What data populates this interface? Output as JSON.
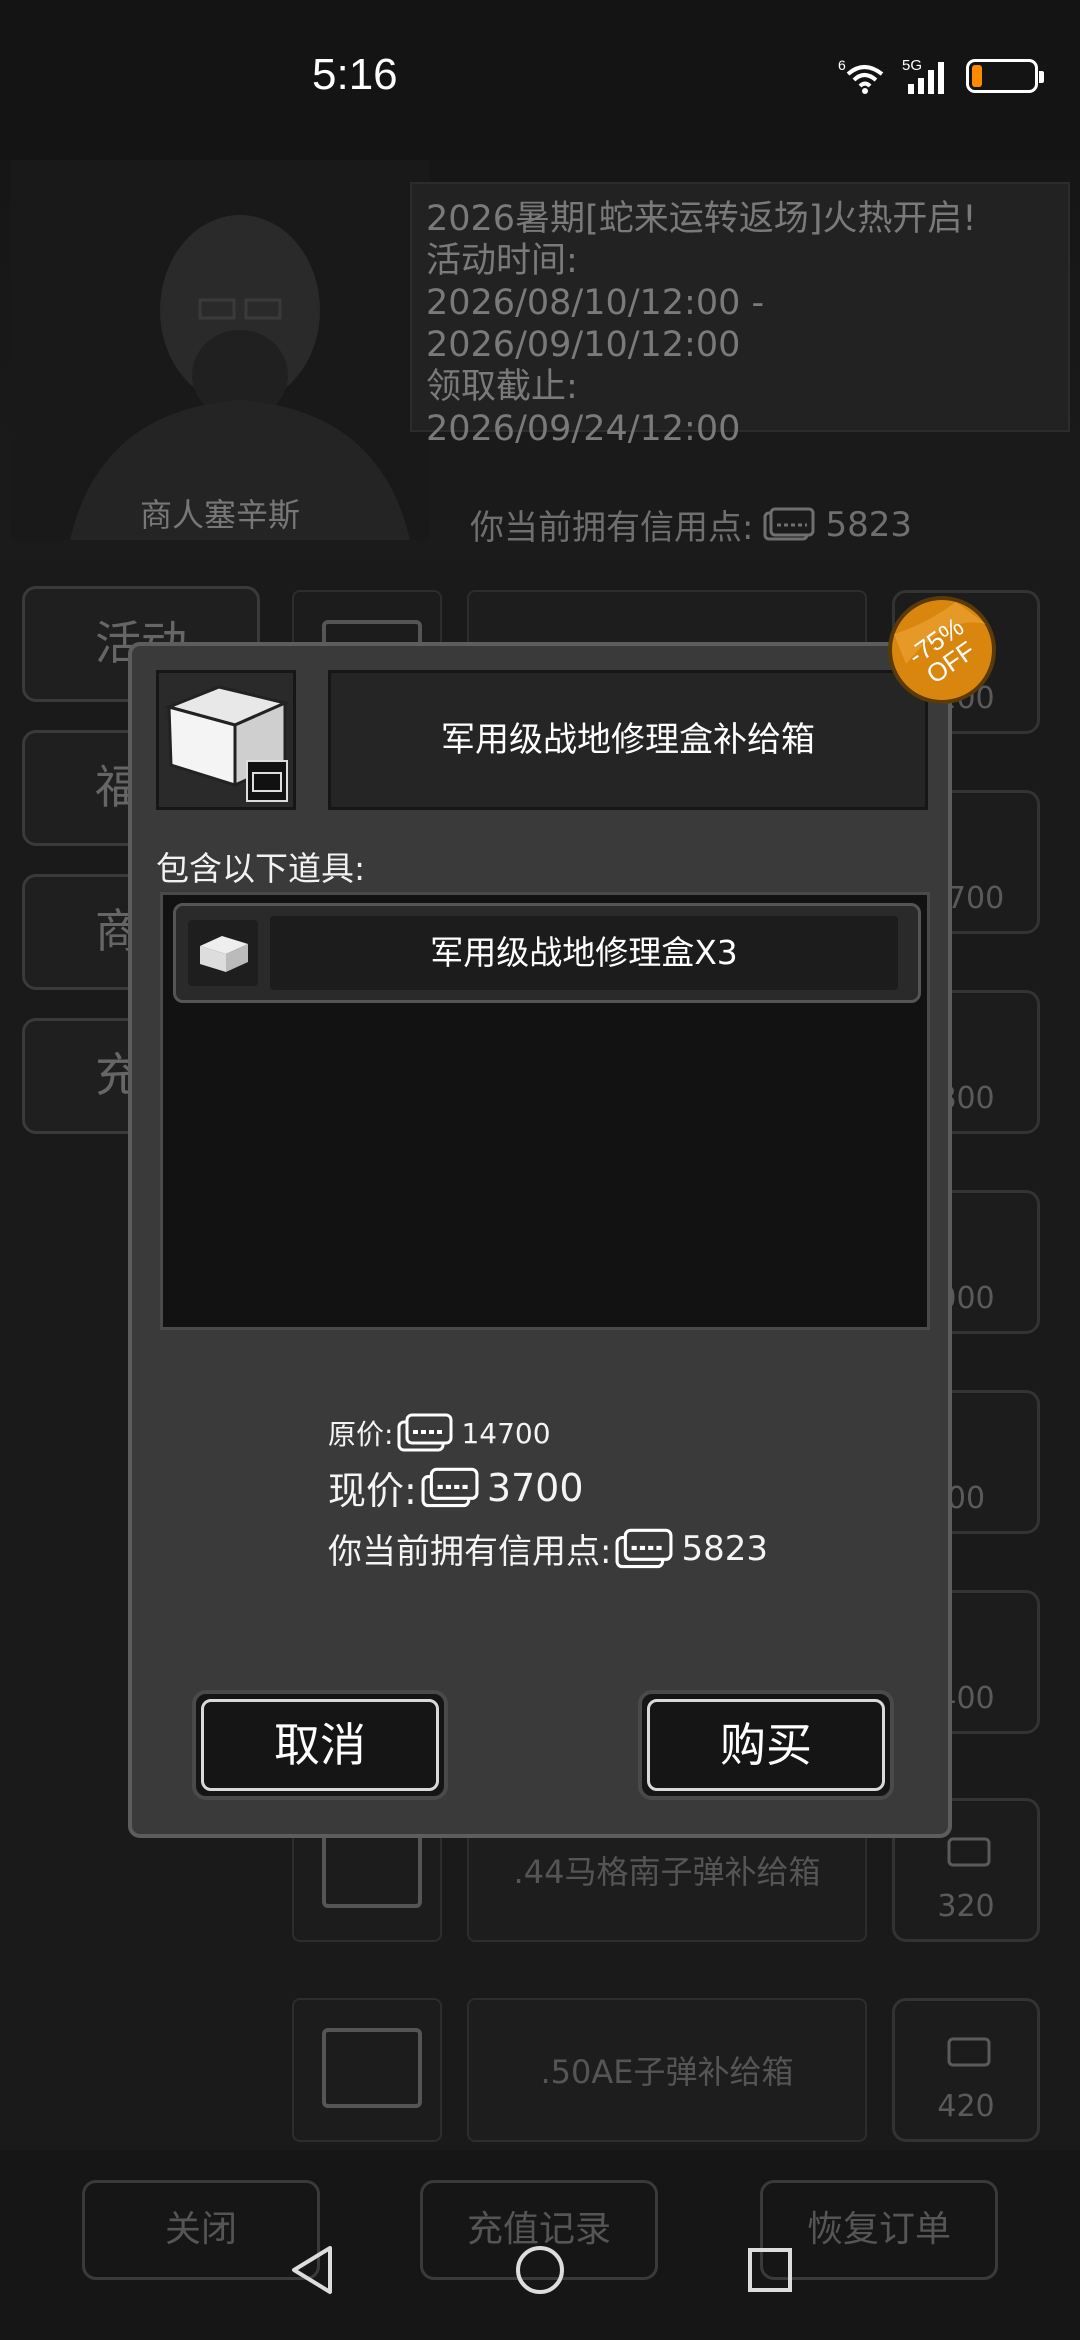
{
  "status_bar": {
    "time": "5:16",
    "icons": [
      "wifi-6-icon",
      "signal-5g-icon",
      "battery-low-icon"
    ],
    "battery_color": "#ff8a00"
  },
  "background": {
    "merchant_name": "商人塞辛斯",
    "announcement": [
      "2026暑期[蛇来运转返场]火热开启!",
      "活动时间:",
      "2026/08/10/12:00 -",
      "2026/09/10/12:00",
      "领取截止:",
      "2026/09/24/12:00"
    ],
    "credits_label": "你当前拥有信用点:",
    "credits_value": "5823",
    "side_tabs": [
      "活动",
      "福",
      "商",
      "充"
    ],
    "shop_rows": [
      {
        "name": "",
        "price": "200"
      },
      {
        "name": "",
        "price": "3700"
      },
      {
        "name": "",
        "price": "800"
      },
      {
        "name": "",
        "price": "000"
      },
      {
        "name": "",
        "price": "00"
      },
      {
        "name": "",
        "price": "400"
      },
      {
        "name": ".44马格南子弹补给箱",
        "price": "320"
      },
      {
        "name": ".50AE子弹补给箱",
        "price": "420"
      }
    ],
    "bottom_buttons": [
      "关闭",
      "充值记录",
      "恢复订单"
    ]
  },
  "modal": {
    "title": "军用级战地修理盒补给箱",
    "includes_label": "包含以下道具:",
    "items": [
      {
        "label": "军用级战地修理盒X3",
        "icon": "repair-box-icon"
      }
    ],
    "original_price_label": "原价:",
    "original_price": "14700",
    "current_price_label": "现价:",
    "current_price": "3700",
    "credits_label": "你当前拥有信用点:",
    "credits_value": "5823",
    "cancel_label": "取消",
    "buy_label": "购买",
    "discount_badge": {
      "line1": "-75%",
      "line2": "OFF",
      "color": "#e08a12"
    }
  },
  "nav": {
    "items": [
      "back-icon",
      "home-icon",
      "recents-icon"
    ]
  }
}
